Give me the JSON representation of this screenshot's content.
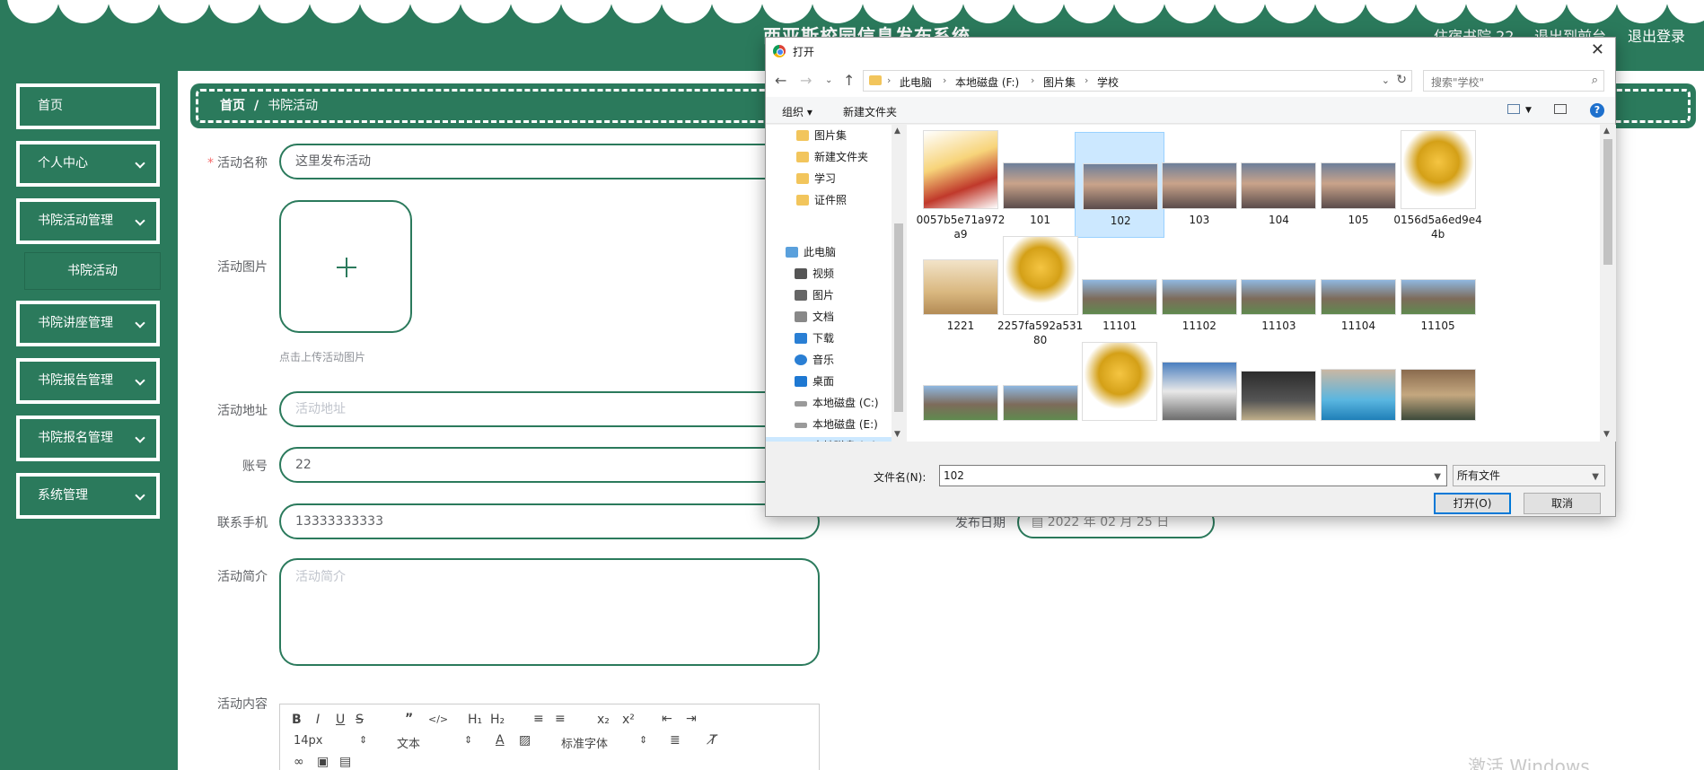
{
  "header": {
    "site_title": "西亚斯校园信息发布系统",
    "user_label": "住宿书院 22",
    "exit_front_label": "退出到前台",
    "logout_label": "退出登录",
    "theme_color": "#2b7a5c"
  },
  "sidebar": {
    "items": [
      {
        "label": "首页"
      },
      {
        "label": "个人中心"
      },
      {
        "label": "书院活动管理"
      },
      {
        "label": "书院讲座管理"
      },
      {
        "label": "书院报告管理"
      },
      {
        "label": "书院报名管理"
      },
      {
        "label": "系统管理"
      }
    ],
    "sub_item": "书院活动"
  },
  "breadcrumb": {
    "home": "首页",
    "separator": "/",
    "current": "书院活动"
  },
  "form": {
    "name_label": "活动名称",
    "name_value": "这里发布活动",
    "image_label": "活动图片",
    "upload_hint": "点击上传活动图片",
    "address_label": "活动地址",
    "address_placeholder": "活动地址",
    "account_label": "账号",
    "account_value": "22",
    "phone_label": "联系手机",
    "phone_value": "13333333333",
    "date_label": "发布日期",
    "date_value": "2022 年 02 月 25 日",
    "intro_label": "活动简介",
    "intro_placeholder": "活动简介",
    "content_label": "活动内容",
    "editor": {
      "font_size": "14px",
      "block_format": "文本",
      "font_family": "标准字体"
    }
  },
  "watermark": "激活 Windows",
  "dialog": {
    "title": "打开",
    "path": [
      "此电脑",
      "本地磁盘 (F:)",
      "图片集",
      "学校"
    ],
    "search_placeholder": "搜索\"学校\"",
    "organize_label": "组织 ▾",
    "new_folder_label": "新建文件夹",
    "tree": [
      {
        "label": "图片集",
        "icon": "folder-icon"
      },
      {
        "label": "新建文件夹",
        "icon": "folder-icon"
      },
      {
        "label": "学习",
        "icon": "folder-icon"
      },
      {
        "label": "证件照",
        "icon": "folder-icon"
      },
      {
        "label": "此电脑",
        "icon": "computer-icon"
      },
      {
        "label": "视频",
        "icon": "video-icon"
      },
      {
        "label": "图片",
        "icon": "pictures-icon"
      },
      {
        "label": "文档",
        "icon": "document-icon"
      },
      {
        "label": "下载",
        "icon": "download-icon"
      },
      {
        "label": "音乐",
        "icon": "music-icon"
      },
      {
        "label": "桌面",
        "icon": "desktop-icon"
      },
      {
        "label": "本地磁盘 (C:)",
        "icon": "drive-icon"
      },
      {
        "label": "本地磁盘 (E:)",
        "icon": "drive-icon"
      },
      {
        "label": "本地磁盘 (F:)",
        "icon": "drive-icon"
      }
    ],
    "files": [
      {
        "name": "0057b5e71a972a9",
        "icon": "trophy-ribbon-image"
      },
      {
        "name": "101",
        "icon": "group-photo-image"
      },
      {
        "name": "102",
        "icon": "group-photo-image"
      },
      {
        "name": "103",
        "icon": "group-photo-image"
      },
      {
        "name": "104",
        "icon": "group-photo-image"
      },
      {
        "name": "105",
        "icon": "group-photo-image"
      },
      {
        "name": "0156d5a6ed9e44b",
        "icon": "trophy-image"
      },
      {
        "name": "1221",
        "icon": "dormitory-image"
      },
      {
        "name": "2257fa592a53180",
        "icon": "trophy-image"
      },
      {
        "name": "11101",
        "icon": "campus-image"
      },
      {
        "name": "11102",
        "icon": "campus-image"
      },
      {
        "name": "11103",
        "icon": "campus-image"
      },
      {
        "name": "11104",
        "icon": "campus-image"
      },
      {
        "name": "11105",
        "icon": "campus-image"
      },
      {
        "name": "",
        "icon": "campus-image"
      },
      {
        "name": "",
        "icon": "campus-image"
      },
      {
        "name": "",
        "icon": "trophy-image"
      },
      {
        "name": "",
        "icon": "building-image"
      },
      {
        "name": "",
        "icon": "book-image"
      },
      {
        "name": "",
        "icon": "pool-image"
      },
      {
        "name": "",
        "icon": "classroom-image"
      }
    ],
    "selected_file": "102",
    "filename_label": "文件名(N):",
    "filename_value": "102",
    "filetype_value": "所有文件",
    "open_button": "打开(O)",
    "cancel_button": "取消"
  }
}
